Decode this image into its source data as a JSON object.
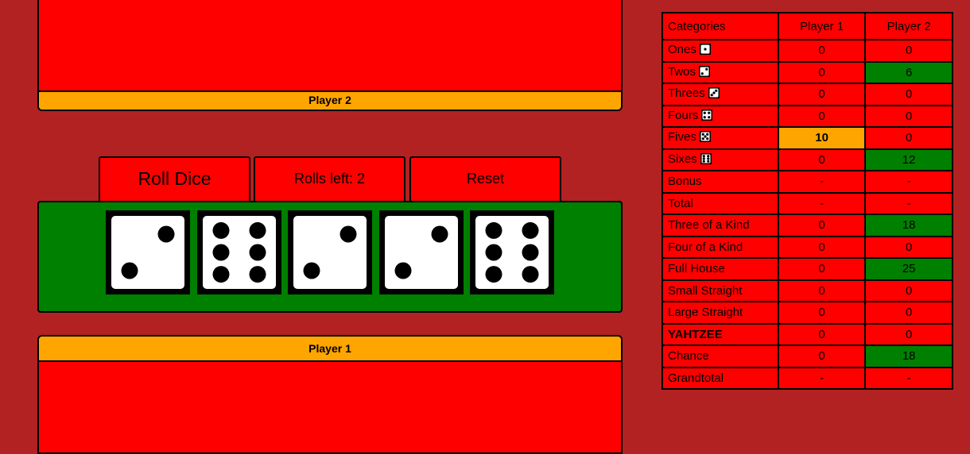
{
  "player2_label": "Player 2",
  "player1_label": "Player 1",
  "controls": {
    "roll": "Roll Dice",
    "rolls_left": "Rolls left: 2",
    "reset": "Reset"
  },
  "dice": [
    {
      "value": 2,
      "icon": "die-two-icon"
    },
    {
      "value": 6,
      "icon": "die-six-icon"
    },
    {
      "value": 2,
      "icon": "die-two-icon"
    },
    {
      "value": 2,
      "icon": "die-two-icon"
    },
    {
      "value": 6,
      "icon": "die-six-icon"
    }
  ],
  "scorecard": {
    "headers": [
      "Categories",
      "Player 1",
      "Player 2"
    ],
    "rows": [
      {
        "label": "Ones",
        "face": 1,
        "p1": "0",
        "p2": "0",
        "p1_state": "normal",
        "p2_state": "normal"
      },
      {
        "label": "Twos",
        "face": 2,
        "p1": "0",
        "p2": "6",
        "p1_state": "normal",
        "p2_state": "scored"
      },
      {
        "label": "Threes",
        "face": 3,
        "p1": "0",
        "p2": "0",
        "p1_state": "normal",
        "p2_state": "normal"
      },
      {
        "label": "Fours",
        "face": 4,
        "p1": "0",
        "p2": "0",
        "p1_state": "normal",
        "p2_state": "normal"
      },
      {
        "label": "Fives",
        "face": 5,
        "p1": "10",
        "p2": "0",
        "p1_state": "highlight",
        "p2_state": "normal"
      },
      {
        "label": "Sixes",
        "face": 6,
        "p1": "0",
        "p2": "12",
        "p1_state": "normal",
        "p2_state": "scored"
      },
      {
        "label": "Bonus",
        "face": 0,
        "p1": "-",
        "p2": "-",
        "p1_state": "normal",
        "p2_state": "normal"
      },
      {
        "label": "Total",
        "face": 0,
        "p1": "-",
        "p2": "-",
        "p1_state": "normal",
        "p2_state": "normal"
      },
      {
        "label": "Three of a Kind",
        "face": 0,
        "p1": "0",
        "p2": "18",
        "p1_state": "normal",
        "p2_state": "scored"
      },
      {
        "label": "Four of a Kind",
        "face": 0,
        "p1": "0",
        "p2": "0",
        "p1_state": "normal",
        "p2_state": "normal"
      },
      {
        "label": "Full House",
        "face": 0,
        "p1": "0",
        "p2": "25",
        "p1_state": "normal",
        "p2_state": "scored"
      },
      {
        "label": "Small Straight",
        "face": 0,
        "p1": "0",
        "p2": "0",
        "p1_state": "normal",
        "p2_state": "normal"
      },
      {
        "label": "Large Straight",
        "face": 0,
        "p1": "0",
        "p2": "0",
        "p1_state": "normal",
        "p2_state": "normal"
      },
      {
        "label": "YAHTZEE",
        "face": 0,
        "bold": true,
        "p1": "0",
        "p2": "0",
        "p1_state": "normal",
        "p2_state": "normal"
      },
      {
        "label": "Chance",
        "face": 0,
        "p1": "0",
        "p2": "18",
        "p1_state": "normal",
        "p2_state": "scored"
      },
      {
        "label": "Grandtotal",
        "face": 0,
        "p1": "-",
        "p2": "-",
        "p1_state": "normal",
        "p2_state": "normal"
      }
    ]
  },
  "colors": {
    "background": "#b22222",
    "panel": "#ff0000",
    "tray": "#008000",
    "player_bar": "#ffa500",
    "scored": "#008000",
    "highlight": "#ffa500"
  }
}
